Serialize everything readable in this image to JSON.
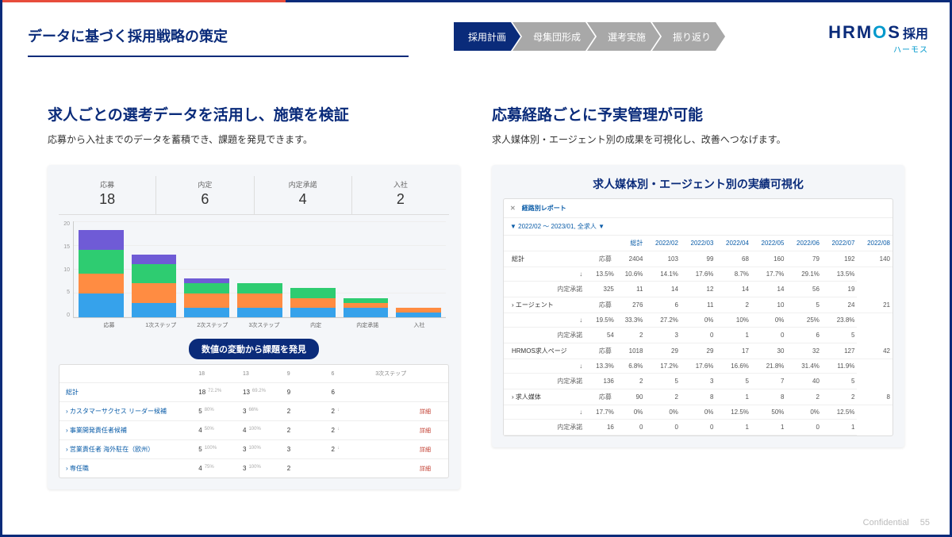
{
  "page_title": "データに基づく採用戦略の策定",
  "stages": [
    "採用計画",
    "母集団形成",
    "選考実施",
    "振り返り"
  ],
  "active_stage_index": 0,
  "logo": {
    "brand": "HRM",
    "brand_o": "O",
    "brand_s": "S",
    "suffix": "採用",
    "katakana": "ハーモス"
  },
  "left": {
    "title": "求人ごとの選考データを活用し、施策を検証",
    "sub": "応募から入社までのデータを蓄積でき、課題を発見できます。",
    "kpis": [
      {
        "label": "応募",
        "value": "18"
      },
      {
        "label": "内定",
        "value": "6"
      },
      {
        "label": "内定承諾",
        "value": "4"
      },
      {
        "label": "入社",
        "value": "2"
      }
    ],
    "y_ticks": [
      "20",
      "15",
      "10",
      "5",
      "0"
    ],
    "x_categories": [
      "応募",
      "1次ステップ",
      "2次ステップ",
      "3次ステップ",
      "内定",
      "内定承諾",
      "入社"
    ],
    "callout": "数値の変動から課題を発見",
    "table": {
      "headers": [
        "",
        "18",
        "",
        "13",
        "",
        "9",
        "6",
        "",
        "3次ステップ"
      ],
      "rows": [
        {
          "name": "総計",
          "c": [
            "18",
            "72.2%",
            "13",
            "69.2%",
            "9",
            ""
          ],
          "last": [
            "6",
            ""
          ],
          "link": ""
        },
        {
          "name": "› カスタマーサクセス  リーダー候補",
          "c": [
            "5",
            "80%",
            "3",
            "66%",
            "2"
          ],
          "last": [
            "2",
            "↓"
          ],
          "link": "詳細"
        },
        {
          "name": "› 事業開発責任者候補",
          "c": [
            "4",
            "50%",
            "4",
            "100%",
            "2"
          ],
          "last": [
            "2",
            "↓"
          ],
          "link": "詳細"
        },
        {
          "name": "› 営業責任者  海外駐在（欧州）",
          "c": [
            "5",
            "100%",
            "3",
            "100%",
            "3"
          ],
          "last": [
            "2",
            "↓"
          ],
          "link": "詳細"
        },
        {
          "name": "› 専任職",
          "c": [
            "4",
            "75%",
            "3",
            "100%",
            "2"
          ],
          "last": [
            "",
            ""
          ],
          "link": "詳細"
        }
      ]
    }
  },
  "right": {
    "title": "応募経路ごとに予実管理が可能",
    "sub": "求人媒体別・エージェント別の成果を可視化し、改善へつなげます。",
    "panel_title": "求人媒体別・エージェント別の実績可視化",
    "report_title": "経路別レポート",
    "filter": "▼ 2022/02 ～ 2023/01, 全求人 ▼",
    "columns": [
      "総計",
      "2022/02",
      "2022/03",
      "2022/04",
      "2022/05",
      "2022/06",
      "2022/07",
      "2022/08"
    ],
    "groups": [
      {
        "name": "総計",
        "rows": [
          {
            "label": "応募",
            "cells": [
              "2404",
              "103",
              "99",
              "68",
              "160",
              "79",
              "192",
              "140"
            ]
          },
          {
            "label": "↓",
            "cells": [
              "13.5%",
              "10.6%",
              "14.1%",
              "17.6%",
              "8.7%",
              "17.7%",
              "29.1%",
              "13.5%"
            ]
          },
          {
            "label": "内定承諾",
            "cells": [
              "325",
              "11",
              "14",
              "12",
              "14",
              "14",
              "56",
              "19"
            ]
          }
        ]
      },
      {
        "name": "› エージェント",
        "rows": [
          {
            "label": "応募",
            "cells": [
              "276",
              "6",
              "11",
              "2",
              "10",
              "5",
              "24",
              "21"
            ]
          },
          {
            "label": "↓",
            "cells": [
              "19.5%",
              "33.3%",
              "27.2%",
              "0%",
              "10%",
              "0%",
              "25%",
              "23.8%"
            ]
          },
          {
            "label": "内定承諾",
            "cells": [
              "54",
              "2",
              "3",
              "0",
              "1",
              "0",
              "6",
              "5"
            ]
          }
        ]
      },
      {
        "name": "HRMOS求人ページ",
        "rows": [
          {
            "label": "応募",
            "cells": [
              "1018",
              "29",
              "29",
              "17",
              "30",
              "32",
              "127",
              "42"
            ]
          },
          {
            "label": "↓",
            "cells": [
              "13.3%",
              "6.8%",
              "17.2%",
              "17.6%",
              "16.6%",
              "21.8%",
              "31.4%",
              "11.9%"
            ]
          },
          {
            "label": "内定承諾",
            "cells": [
              "136",
              "2",
              "5",
              "3",
              "5",
              "7",
              "40",
              "5"
            ]
          }
        ]
      },
      {
        "name": "› 求人媒体",
        "rows": [
          {
            "label": "応募",
            "cells": [
              "90",
              "2",
              "8",
              "1",
              "8",
              "2",
              "2",
              "8"
            ]
          },
          {
            "label": "↓",
            "cells": [
              "17.7%",
              "0%",
              "0%",
              "0%",
              "12.5%",
              "50%",
              "0%",
              "12.5%"
            ]
          },
          {
            "label": "内定承諾",
            "cells": [
              "16",
              "0",
              "0",
              "0",
              "1",
              "1",
              "0",
              "1"
            ]
          }
        ]
      }
    ]
  },
  "footer": {
    "conf": "Confidential",
    "page": "55"
  },
  "chart_data": {
    "type": "bar",
    "stacked": true,
    "ylim": [
      0,
      20
    ],
    "categories": [
      "応募",
      "1次ステップ",
      "2次ステップ",
      "3次ステップ",
      "内定",
      "内定承諾",
      "入社"
    ],
    "series_colors": {
      "a": "#36a2eb",
      "b": "#ff8c42",
      "c": "#2ecc71",
      "d": "#6f5bd6"
    },
    "stacks": [
      [
        5,
        4,
        5,
        4
      ],
      [
        3,
        4,
        4,
        2
      ],
      [
        2,
        3,
        2,
        1
      ],
      [
        2,
        3,
        2,
        0
      ],
      [
        2,
        2,
        2,
        0
      ],
      [
        2,
        1,
        1,
        0
      ],
      [
        1,
        1,
        0,
        0
      ]
    ]
  }
}
